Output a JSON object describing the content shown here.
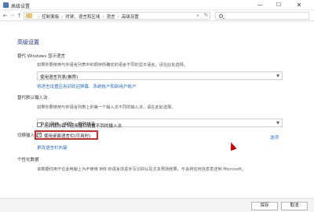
{
  "window": {
    "title": "高级设置",
    "min_label": "—",
    "max_label": "☐",
    "close_label": "✕"
  },
  "addressbar": {
    "back": "←",
    "forward": "→",
    "up": "↑",
    "breadcrumbs": [
      "控制面板",
      "时钟、语言和区域",
      "语言",
      "高级设置"
    ],
    "dropdown": "∨",
    "refresh": "↻"
  },
  "page": {
    "heading": "高级设置",
    "override_display": {
      "label": "替代 Windows 显示语言",
      "desc": "如果你要使用与你语言列表中的顺序所确定的语言不同的显示语言，请在此处选择。",
      "selected": "使用语言列表(推荐)",
      "link": "将语言设置应用到欢迎屏幕、系统帐户和新用户帐户"
    },
    "override_input": {
      "label": "替代默认输入法",
      "desc": "如果你要使用与你语言列表上的第一个输入法不同的输入法，请在此处选择。",
      "selected": "中文(简体，中国) - 微软拼音"
    },
    "switch_input": {
      "label": "切换输入法",
      "option1": "允许我为每个应用窗口设置不同的输入法",
      "option1_checked": false,
      "option2": "使用桌面语言栏(可用时)",
      "option2_checked": true,
      "options_link": "选项",
      "hotkey_link": "更改语言栏热键"
    },
    "personal": {
      "label": "个性化数据",
      "desc": "该数据仅用于在此电脑上为不使用 IME 的语言改进手写识别以及文本预测结果。不会将任何信息发送到 Microsoft。"
    }
  },
  "footer": {
    "save": "保存",
    "cancel": "取消"
  }
}
